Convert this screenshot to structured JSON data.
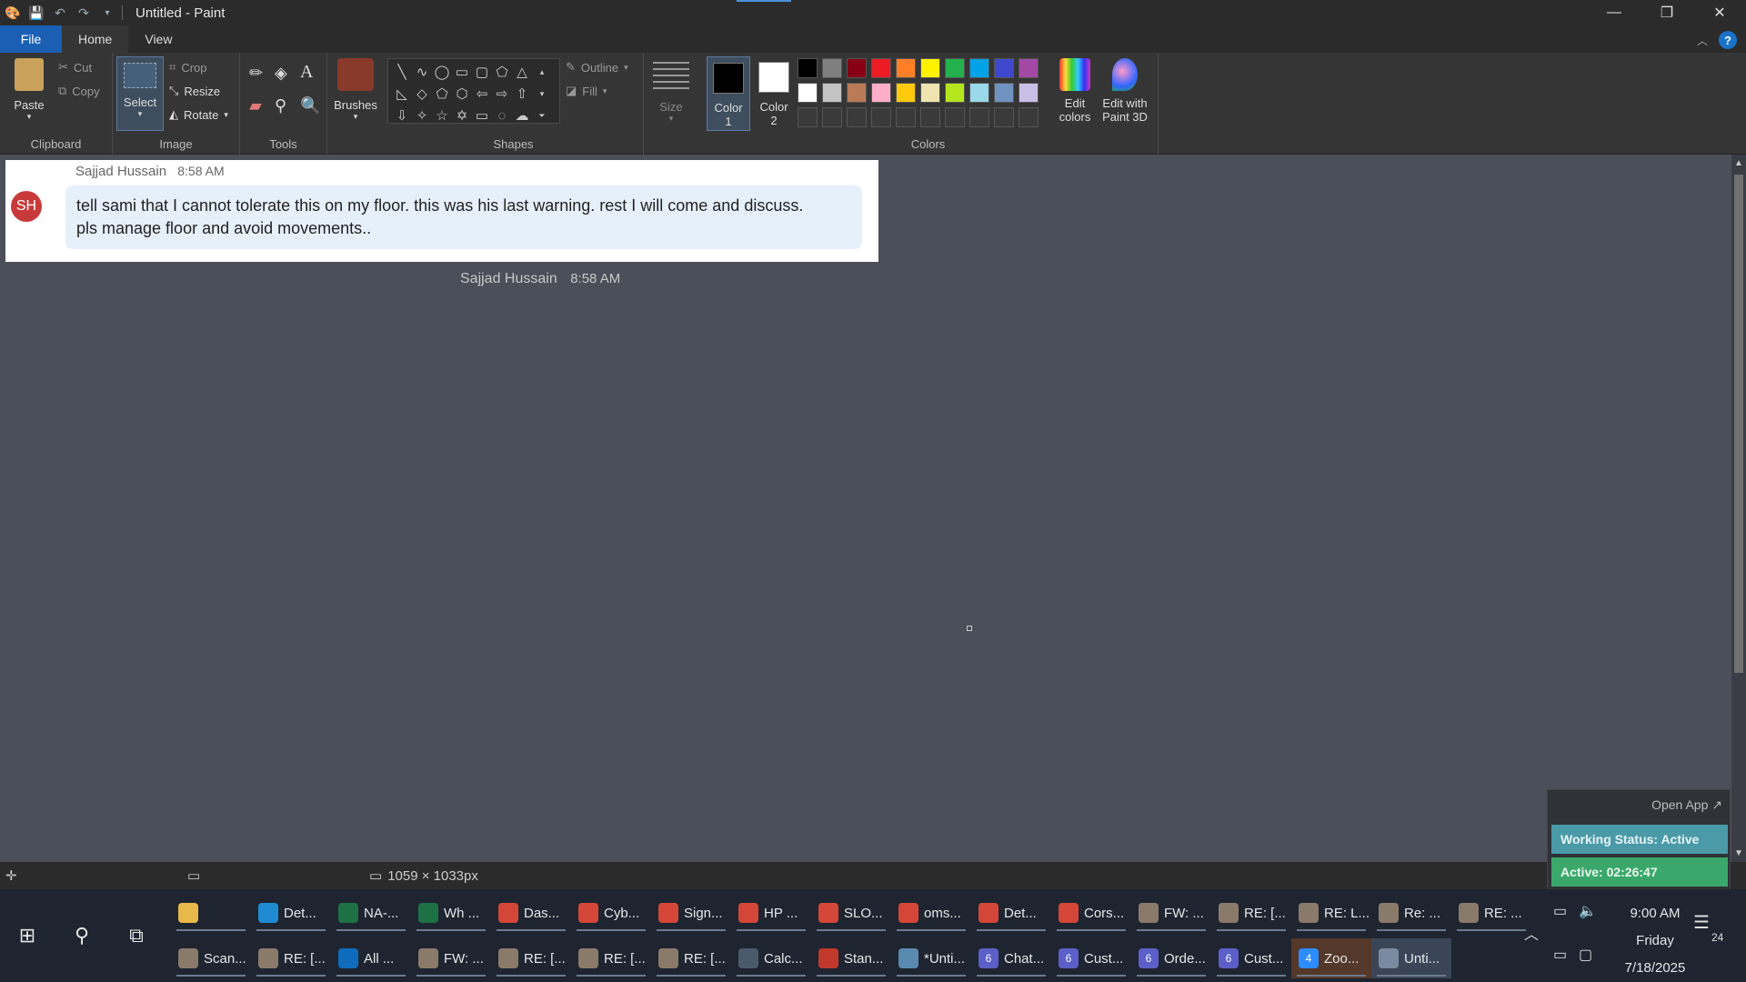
{
  "titlebar": {
    "title": "Untitled - Paint"
  },
  "menu": {
    "file": "File",
    "home": "Home",
    "view": "View"
  },
  "ribbon": {
    "clipboard": {
      "label": "Clipboard",
      "paste": "Paste",
      "cut": "Cut",
      "copy": "Copy"
    },
    "image": {
      "label": "Image",
      "select": "Select",
      "crop": "Crop",
      "resize": "Resize",
      "rotate": "Rotate"
    },
    "tools": {
      "label": "Tools"
    },
    "brushes": {
      "label": "Brushes"
    },
    "shapes": {
      "label": "Shapes",
      "outline": "Outline",
      "fill": "Fill"
    },
    "size": {
      "label": "Size"
    },
    "colors": {
      "label": "Colors",
      "color1": "Color",
      "color1_num": "1",
      "color2": "Color",
      "color2_num": "2",
      "edit_colors_1": "Edit",
      "edit_colors_2": "colors",
      "edit_3d_1": "Edit with",
      "edit_3d_2": "Paint 3D"
    }
  },
  "palette_colors": [
    "#000000",
    "#7f7f7f",
    "#880015",
    "#ed1c24",
    "#ff7f27",
    "#fff200",
    "#22b14c",
    "#00a2e8",
    "#3f48cc",
    "#a349a4",
    "#ffffff",
    "#c3c3c3",
    "#b97a57",
    "#ffaec9",
    "#ffc90e",
    "#efe4b0",
    "#b5e61d",
    "#99d9ea",
    "#7092be",
    "#c8bfe7"
  ],
  "chat": {
    "sender": "Sajjad Hussain",
    "time": "8:58 AM",
    "avatar": "SH",
    "message_line1": "tell sami that I cannot tolerate this on my floor. this was his last warning. rest I will come and discuss.",
    "message_line2": "pls manage floor and avoid movements..",
    "sender2": "Sajjad Hussain",
    "time2": "8:58 AM"
  },
  "statusbar": {
    "dimensions": "1059 × 1033px"
  },
  "overlay": {
    "open_app": "Open App ↗",
    "status": "Working Status: Active",
    "active": "Active: 02:26:47"
  },
  "taskbar": {
    "row1": [
      {
        "icon": "folder-icon",
        "label": "",
        "color": "#e8b84a"
      },
      {
        "icon": "edge-icon",
        "label": "Det...",
        "color": "#1f8ad2"
      },
      {
        "icon": "excel-icon",
        "label": "NA-...",
        "color": "#1e7145"
      },
      {
        "icon": "excel-icon",
        "label": "Wh ...",
        "color": "#1e7145"
      },
      {
        "icon": "chrome-icon",
        "label": "Das...",
        "color": "#d44638"
      },
      {
        "icon": "chrome-icon",
        "label": "Cyb...",
        "color": "#d44638"
      },
      {
        "icon": "chrome-icon",
        "label": "Sign...",
        "color": "#d44638"
      },
      {
        "icon": "chrome-icon",
        "label": "HP ...",
        "color": "#d44638"
      },
      {
        "icon": "chrome-icon",
        "label": "SLO...",
        "color": "#d44638"
      },
      {
        "icon": "chrome-icon",
        "label": "oms...",
        "color": "#d44638"
      },
      {
        "icon": "chrome-icon",
        "label": "Det...",
        "color": "#d44638"
      },
      {
        "icon": "chrome-icon",
        "label": "Cors...",
        "color": "#d44638"
      },
      {
        "icon": "mail-icon",
        "label": "FW: ...",
        "color": "#8a7a6a"
      },
      {
        "icon": "mail-icon",
        "label": "RE: [...",
        "color": "#8a7a6a"
      },
      {
        "icon": "mail-icon",
        "label": "RE: L...",
        "color": "#8a7a6a"
      },
      {
        "icon": "mail-icon",
        "label": "Re: ...",
        "color": "#8a7a6a"
      },
      {
        "icon": "mail-icon",
        "label": "RE: ...",
        "color": "#8a7a6a"
      }
    ],
    "row2": [
      {
        "icon": "mail-icon",
        "label": "Scan...",
        "color": "#8a7a6a"
      },
      {
        "icon": "mail-icon",
        "label": "RE: [...",
        "color": "#8a7a6a"
      },
      {
        "icon": "outlook-icon",
        "label": "All ...",
        "color": "#0f6cbd"
      },
      {
        "icon": "mail-icon",
        "label": "FW: ...",
        "color": "#8a7a6a"
      },
      {
        "icon": "mail-icon",
        "label": "RE: [...",
        "color": "#8a7a6a"
      },
      {
        "icon": "mail-icon",
        "label": "RE: [...",
        "color": "#8a7a6a"
      },
      {
        "icon": "mail-icon",
        "label": "RE: [...",
        "color": "#8a7a6a"
      },
      {
        "icon": "calculator-icon",
        "label": "Calc...",
        "color": "#4a5a6a"
      },
      {
        "icon": "pdf-icon",
        "label": "Stan...",
        "color": "#c0392b"
      },
      {
        "icon": "notepad-icon",
        "label": "*Unti...",
        "color": "#5a8ab0"
      },
      {
        "icon": "teams-icon",
        "label": "Chat...",
        "color": "#5b5fc7",
        "badge": "6"
      },
      {
        "icon": "teams-icon",
        "label": "Cust...",
        "color": "#5b5fc7",
        "badge": "6"
      },
      {
        "icon": "teams-icon",
        "label": "Orde...",
        "color": "#5b5fc7",
        "badge": "6"
      },
      {
        "icon": "teams-icon",
        "label": "Cust...",
        "color": "#5b5fc7",
        "badge": "6"
      },
      {
        "icon": "zoom-icon",
        "label": "Zoo...",
        "color": "#2d8cff",
        "badge": "4"
      },
      {
        "icon": "paint-icon",
        "label": "Unti...",
        "color": "#7a8aa0"
      }
    ]
  },
  "tray": {
    "time": "9:00 AM",
    "day": "Friday",
    "date": "7/18/2025",
    "notifications": "24"
  }
}
